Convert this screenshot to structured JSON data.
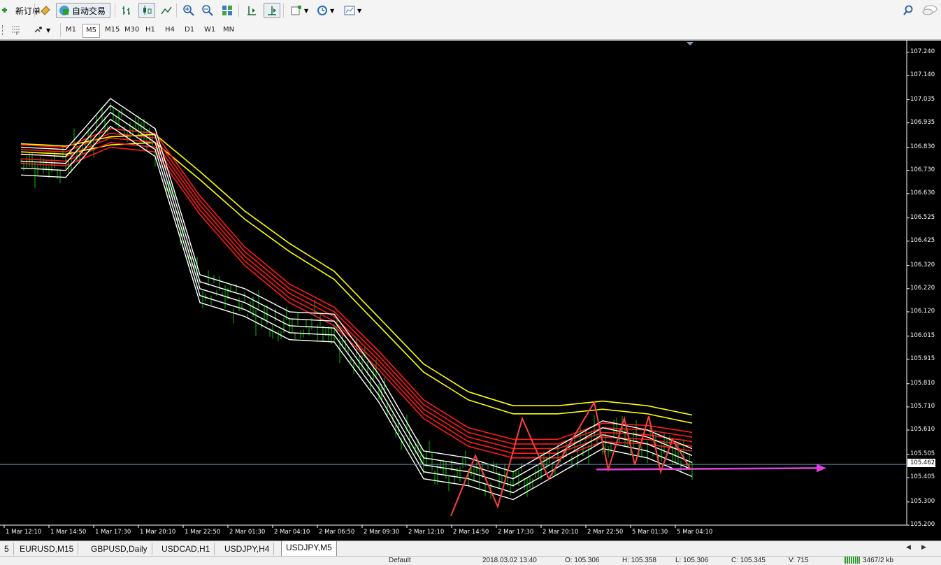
{
  "toolbar": {
    "new_order": "新订单",
    "auto_trading": "自动交易"
  },
  "timeframes": [
    "M1",
    "M5",
    "M15",
    "M30",
    "H1",
    "H4",
    "D1",
    "W1",
    "MN"
  ],
  "active_timeframe": "M5",
  "chart": {
    "current_price": "105.462",
    "price_labels": [
      "107.240",
      "107.140",
      "107.035",
      "106.935",
      "106.830",
      "106.730",
      "106.630",
      "106.525",
      "106.425",
      "106.320",
      "106.220",
      "106.120",
      "106.015",
      "105.915",
      "105.810",
      "105.710",
      "105.610",
      "105.505",
      "105.405",
      "105.300",
      "105.200"
    ],
    "time_labels": [
      "1 Mar 12:10",
      "1 Mar 14:50",
      "1 Mar 17:30",
      "1 Mar 20:10",
      "1 Mar 22:50",
      "2 Mar 01:30",
      "2 Mar 04:10",
      "2 Mar 06:50",
      "2 Mar 09:30",
      "2 Mar 12:10",
      "2 Mar 14:50",
      "2 Mar 17:30",
      "2 Mar 20:10",
      "2 Mar 22:50",
      "5 Mar 01:30",
      "5 Mar 04:10"
    ],
    "colors": {
      "background": "#000000",
      "bull": "#00c000",
      "bear": "#00c000",
      "ema_white": "#ffffff",
      "ema_red": "#ff1a1a",
      "ema_yellow": "#ffff00",
      "arrow": "#e040e0",
      "zigzag": "#ff4040"
    }
  },
  "chart_data": {
    "type": "line",
    "symbol": "USDJPY",
    "timeframe": "M5",
    "ylim": [
      105.2,
      107.29
    ],
    "x": [
      "1 Mar 12:10",
      "1 Mar 14:50",
      "1 Mar 17:30",
      "1 Mar 20:10",
      "1 Mar 22:50",
      "2 Mar 01:30",
      "2 Mar 04:10",
      "2 Mar 06:50",
      "2 Mar 09:30",
      "2 Mar 12:10",
      "2 Mar 14:50",
      "2 Mar 17:30",
      "2 Mar 20:10",
      "2 Mar 22:50",
      "5 Mar 01:30",
      "5 Mar 04:10"
    ],
    "series": [
      {
        "values": [
          106.77,
          106.76,
          106.98,
          106.85,
          106.22,
          106.16,
          106.06,
          106.05,
          105.79,
          105.46,
          105.43,
          105.37,
          105.48,
          105.59,
          105.55,
          105.47
        ]
      },
      {
        "values": [
          106.8,
          106.79,
          106.87,
          106.85,
          106.58,
          106.36,
          106.2,
          106.1,
          105.91,
          105.7,
          105.58,
          105.53,
          105.53,
          105.6,
          105.59,
          105.56
        ]
      },
      {
        "values": [
          106.81,
          106.8,
          106.84,
          106.85,
          106.69,
          106.52,
          106.38,
          106.26,
          106.06,
          105.86,
          105.74,
          105.68,
          105.68,
          105.7,
          105.68,
          105.64
        ]
      }
    ]
  },
  "tabs": [
    "5",
    "EURUSD,M15",
    "GBPUSD,Daily",
    "USDCAD,H1",
    "USDJPY,H4",
    "USDJPY,M5"
  ],
  "active_tab": "USDJPY,M5",
  "status": {
    "profile": "Default",
    "datetime": "2018.03.02 13:40",
    "open": "O: 105.306",
    "high": "H: 105.358",
    "low": "L: 105.306",
    "close": "C: 105.345",
    "volume": "V: 715",
    "traffic": "3467/2 kb"
  }
}
